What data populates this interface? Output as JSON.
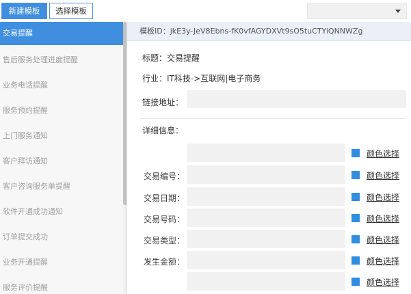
{
  "toolbar": {
    "new_template": "新建模板",
    "choose_template": "选择模板",
    "select_value": ""
  },
  "sidebar": {
    "items": [
      {
        "label": "交易提醒",
        "active": true
      },
      {
        "label": "售后服务处理进度提醒"
      },
      {
        "label": "业务电话提醒"
      },
      {
        "label": "服务预约提醒"
      },
      {
        "label": "上门服务通知"
      },
      {
        "label": "客户拜访通知"
      },
      {
        "label": "客户咨询服务单提醒"
      },
      {
        "label": "软件开通成功通知"
      },
      {
        "label": "订单提交成功"
      },
      {
        "label": "业务开通提醒"
      },
      {
        "label": "服务评价提醒"
      }
    ]
  },
  "main": {
    "template_id": "模板ID：jkE3y-JeV8Ebns-fK0vfAGYDXVt9sO5tuCTYiQNNWZg",
    "title": "标题：交易提醒",
    "industry": "行业：IT科技->互联网|电子商务",
    "link_label": "链接地址：",
    "link_value": "",
    "details_label": "详细信息：",
    "color_link": "颜色选择",
    "rows": [
      {
        "label": "",
        "value": ""
      },
      {
        "label": "交易编号：",
        "value": ""
      },
      {
        "label": "交易日期：",
        "value": ""
      },
      {
        "label": "交易号码：",
        "value": ""
      },
      {
        "label": "交易类型：",
        "value": ""
      },
      {
        "label": "发生金额：",
        "value": ""
      },
      {
        "label": "",
        "value": ""
      }
    ]
  },
  "colors": {
    "accent": "#3f8ee0",
    "id_bar": "#e9f0f8",
    "field_bg": "#f1f1f1"
  }
}
